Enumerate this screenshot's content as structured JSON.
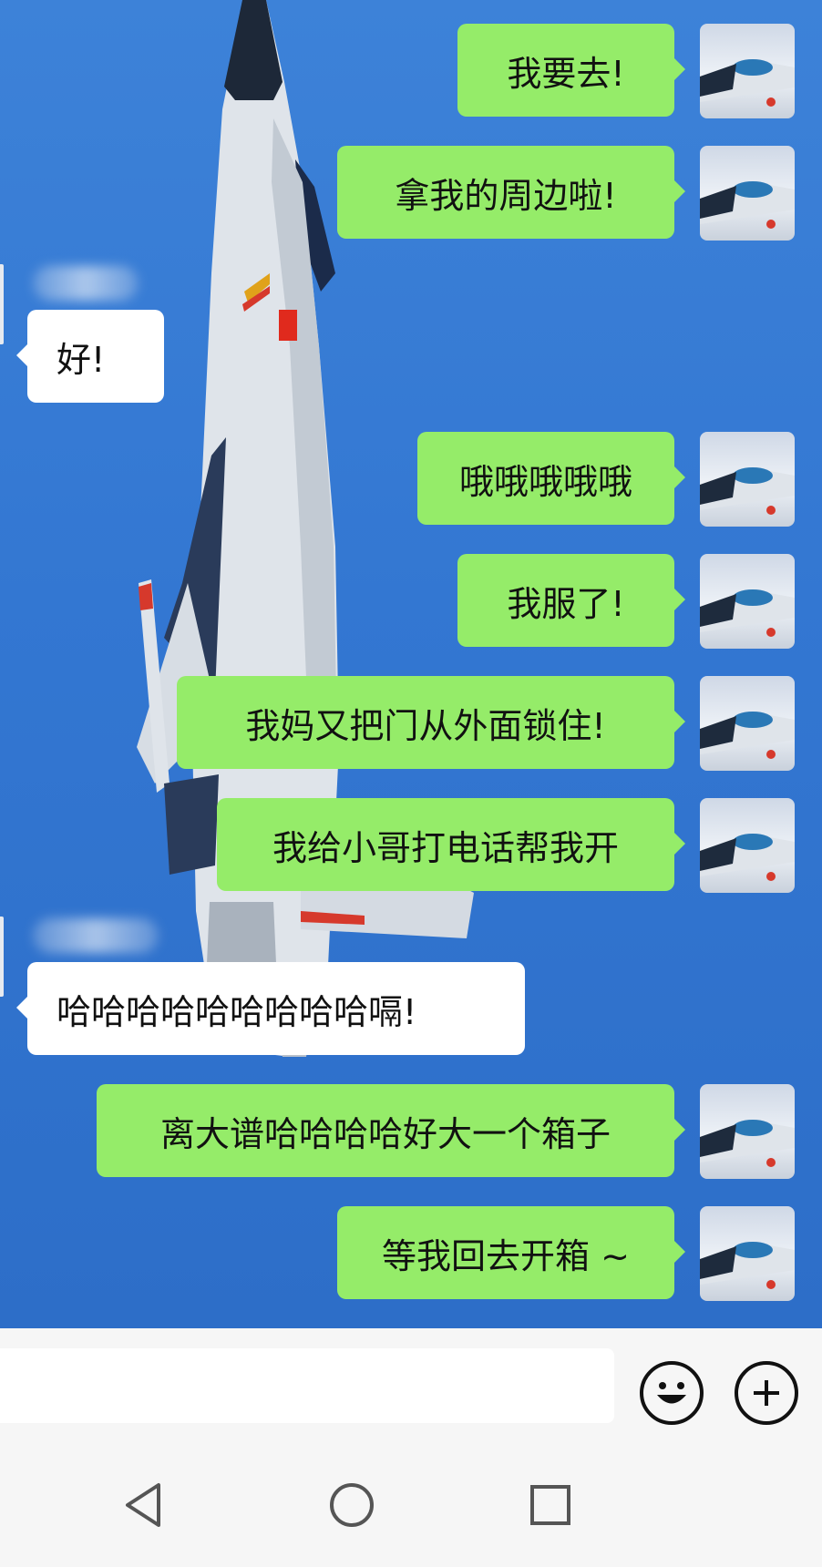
{
  "messages": [
    {
      "side": "out",
      "text": "我要去!"
    },
    {
      "side": "out",
      "text": "拿我的周边啦!"
    },
    {
      "side": "in",
      "text": "好!"
    },
    {
      "side": "out",
      "text": "哦哦哦哦哦"
    },
    {
      "side": "out",
      "text": "我服了!"
    },
    {
      "side": "out",
      "text": "我妈又把门从外面锁住!"
    },
    {
      "side": "out",
      "text": "我给小哥打电话帮我开"
    },
    {
      "side": "in",
      "text": "哈哈哈哈哈哈哈哈哈嗝!"
    },
    {
      "side": "out",
      "text": "离大谱哈哈哈哈好大一个箱子"
    },
    {
      "side": "out",
      "text": "等我回去开箱 ~"
    }
  ],
  "input": {
    "value": "",
    "placeholder": ""
  },
  "icons": {
    "emoji": "smiley-face-icon",
    "more": "plus-circle-icon",
    "nav_back": "triangle-back-icon",
    "nav_home": "circle-home-icon",
    "nav_recents": "square-recents-icon"
  },
  "colors": {
    "outgoing_bubble": "#95ec69",
    "incoming_bubble": "#ffffff",
    "chat_background": "#3377d2",
    "bar_background": "#f6f6f6"
  }
}
